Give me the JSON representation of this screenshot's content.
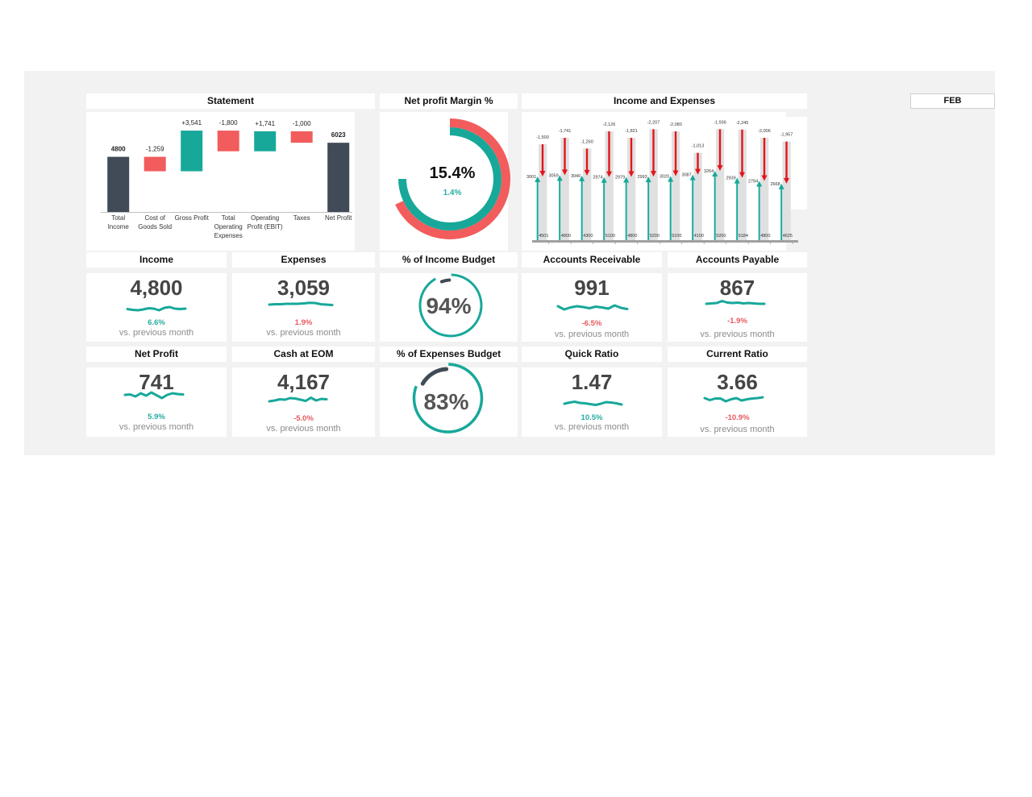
{
  "dashboard": {
    "period_selector": {
      "value": "FEB"
    },
    "kpis": [
      {
        "title": "Income",
        "value": "4,800",
        "change": "6.6%",
        "trend": "positive",
        "vs_label": "vs. previous month",
        "sparkline": [
          0.45,
          0.35,
          0.3,
          0.4,
          0.55,
          0.5,
          0.3,
          0.6,
          0.7,
          0.5,
          0.45,
          0.5
        ]
      },
      {
        "title": "Expenses",
        "value": "3,059",
        "change": "1.9%",
        "trend": "negative",
        "vs_label": "vs. previous month",
        "sparkline": [
          0.4,
          0.45,
          0.45,
          0.5,
          0.5,
          0.5,
          0.55,
          0.62,
          0.6,
          0.45,
          0.4,
          0.35
        ]
      },
      {
        "title": "Accounts Receivable",
        "value": "991",
        "change": "-6.5%",
        "trend": "negative",
        "vs_label": "vs. previous month",
        "sparkline": [
          0.6,
          0.2,
          0.45,
          0.6,
          0.5,
          0.35,
          0.55,
          0.45,
          0.3,
          0.7,
          0.4,
          0.25
        ]
      },
      {
        "title": "Accounts Payable",
        "value": "867",
        "change": "-1.9%",
        "trend": "negative",
        "vs_label": "vs. previous month",
        "sparkline": [
          0.4,
          0.45,
          0.5,
          0.75,
          0.55,
          0.5,
          0.55,
          0.45,
          0.5,
          0.45,
          0.4,
          0.4
        ]
      },
      {
        "title": "Net Profit",
        "value": "741",
        "change": "5.9%",
        "trend": "positive",
        "vs_label": "vs. previous month",
        "sparkline": [
          0.5,
          0.55,
          0.3,
          0.7,
          0.4,
          0.8,
          0.45,
          0.1,
          0.5,
          0.7,
          0.6,
          0.55
        ]
      },
      {
        "title": "Cash at EOM",
        "value": "4,167",
        "change": "-5.0%",
        "trend": "negative",
        "vs_label": "vs. previous month",
        "sparkline": [
          0.3,
          0.4,
          0.55,
          0.5,
          0.7,
          0.65,
          0.5,
          0.35,
          0.75,
          0.4,
          0.6,
          0.55
        ]
      },
      {
        "title": "Quick Ratio",
        "value": "1.47",
        "change": "10.5%",
        "trend": "positive",
        "vs_label": "vs. previous month",
        "sparkline": [
          0.4,
          0.55,
          0.65,
          0.5,
          0.45,
          0.35,
          0.25,
          0.4,
          0.6,
          0.55,
          0.45,
          0.3
        ]
      },
      {
        "title": "Current Ratio",
        "value": "3.66",
        "change": "-10.9%",
        "trend": "negative",
        "vs_label": "vs. previous month",
        "sparkline": [
          0.6,
          0.35,
          0.55,
          0.55,
          0.2,
          0.45,
          0.6,
          0.3,
          0.45,
          0.55,
          0.6,
          0.7
        ]
      }
    ],
    "gauges": [
      {
        "title": "% of Income Budget",
        "value": "94%",
        "fraction": 0.94
      },
      {
        "title": "% of Expenses Budget",
        "value": "83%",
        "fraction": 0.83
      }
    ],
    "colors": {
      "teal": "#17a89a",
      "coral": "#f25c5c",
      "slate": "#404b57",
      "arrow_red": "#e3151b",
      "bar_gray": "#e0e0e0"
    }
  },
  "chart_data": [
    {
      "id": "statement",
      "type": "bar",
      "subtype": "waterfall",
      "title": "Statement",
      "categories": [
        "Total\nIncome",
        "Cost of\nGoods Sold",
        "Gross Profit",
        "Total\nOperating\nExpenses",
        "Operating\nProfit (EBIT)",
        "Taxes",
        "Net Profit"
      ],
      "values": [
        4800,
        -1259,
        3541,
        -1800,
        1741,
        -1000,
        6023
      ],
      "measures": [
        "total",
        "relative",
        "relative",
        "relative",
        "relative",
        "relative",
        "total"
      ],
      "data_labels": [
        "4800",
        "-1,259",
        "+3,541",
        "-1,800",
        "+1,741",
        "-1,000",
        "6023"
      ],
      "ylim": [
        0,
        8700
      ],
      "grid": false,
      "colors": {
        "total": "#404b57",
        "increase": "#17a89a",
        "decrease": "#f25c5c"
      }
    },
    {
      "id": "net_profit_margin",
      "type": "pie",
      "subtype": "donut",
      "title": "Net profit Margin %",
      "center_label": "15.4%",
      "sub_label": "1.4%",
      "rings": [
        {
          "name": "outer",
          "fraction": 0.68,
          "color": "#f25c5c"
        },
        {
          "name": "inner",
          "fraction": 0.75,
          "color": "#17a89a"
        }
      ]
    },
    {
      "id": "income_expenses",
      "type": "bar",
      "subtype": "arrow-waterfall",
      "title": "Income and Expenses",
      "ylim": [
        0,
        6000
      ],
      "grid": false,
      "series": [
        {
          "name": "Income",
          "values": [
            4501,
            4800,
            4300,
            5100,
            4800,
            5200,
            5100,
            4100,
            5200,
            5184,
            4800,
            4625
          ],
          "color": "#e0e0e0"
        },
        {
          "name": "Expenses",
          "values": [
            -1500,
            -1741,
            -1260,
            -2126,
            -1821,
            -2207,
            -2080,
            -1013,
            -1936,
            -2245,
            -2006,
            -1957
          ],
          "color": "#e3151b"
        },
        {
          "name": "Net",
          "values": [
            3001,
            3059,
            3040,
            2974,
            2979,
            2993,
            3020,
            3087,
            3264,
            2939,
            2794,
            2668
          ],
          "color": "#17a89a"
        }
      ],
      "data_labels": {
        "income": [
          "4501",
          "4800",
          "4300",
          "5100",
          "4800",
          "5200",
          "5100",
          "4100",
          "5200",
          "5184",
          "4800",
          "4625"
        ],
        "expenses": [
          "-1,500",
          "-1,741",
          "-1,260",
          "-2,126",
          "-1,821",
          "-2,207",
          "-2,080",
          "-1,013",
          "-1,936",
          "-2,245",
          "-2,006",
          "-1,957"
        ],
        "net": [
          "3001",
          "3059",
          "3040",
          "2974",
          "2979",
          "2993",
          "3020",
          "3087",
          "3264",
          "2939",
          "2794",
          "2668"
        ]
      }
    }
  ]
}
